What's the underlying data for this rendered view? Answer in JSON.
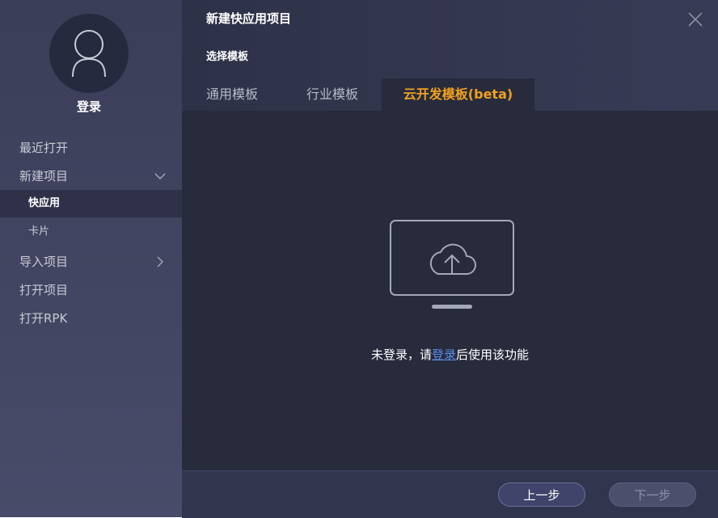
{
  "sidebar": {
    "login_label": "登录",
    "items": [
      {
        "label": "最近打开"
      },
      {
        "label": "新建项目"
      },
      {
        "label": "快应用"
      },
      {
        "label": "卡片"
      },
      {
        "label": "导入项目"
      },
      {
        "label": "打开项目"
      },
      {
        "label": "打开RPK"
      }
    ]
  },
  "dialog": {
    "title": "新建快应用项目",
    "section_label": "选择模板",
    "tabs": [
      {
        "label": "通用模板"
      },
      {
        "label": "行业模板"
      },
      {
        "label": "云开发模板(beta)"
      }
    ],
    "active_tab": 2
  },
  "content": {
    "icon": "cloud-upload-monitor-icon",
    "message_before": "未登录，请",
    "message_link": "登录",
    "message_after": "后使用该功能"
  },
  "footer": {
    "prev_label": "上一步",
    "next_label": "下一步"
  },
  "colors": {
    "accent": "#f0a020",
    "link": "#5b8de8",
    "sidebar_bg": "#3f4260",
    "main_bg": "#272b3c"
  }
}
